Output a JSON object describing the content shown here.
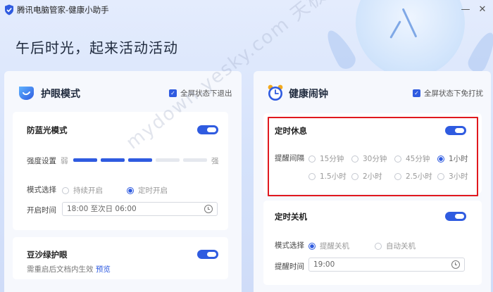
{
  "window": {
    "title": "腾讯电脑管家-健康小助手",
    "controls": {
      "minimize": "—",
      "close": "✕"
    }
  },
  "headline": "午后时光，起来活动活动",
  "watermark": "mydown.yesky.com 天极下载站",
  "eye_panel": {
    "title": "护眼模式",
    "fullscreen_exit_label": "全屏状态下退出",
    "blue_light": {
      "title": "防蓝光模式",
      "enabled": true,
      "intensity_label": "强度设置",
      "weak_label": "弱",
      "strong_label": "强",
      "intensity_level": 0.6,
      "mode_label": "模式选择",
      "modes": [
        {
          "label": "持续开启",
          "selected": false
        },
        {
          "label": "定时开启",
          "selected": true
        }
      ],
      "time_label": "开启时间",
      "time_value": "18:00 至次日 06:00"
    },
    "green_eye": {
      "title": "豆沙绿护眼",
      "enabled": true,
      "note": "需重启后文档内生效",
      "preview_link": "预览"
    }
  },
  "alarm_panel": {
    "title": "健康闹钟",
    "fullscreen_dnd_label": "全屏状态下免打扰",
    "timed_rest": {
      "title": "定时休息",
      "enabled": true,
      "interval_label": "提醒间隔",
      "options": [
        {
          "label": "15分钟",
          "selected": false
        },
        {
          "label": "30分钟",
          "selected": false
        },
        {
          "label": "45分钟",
          "selected": false
        },
        {
          "label": "1小时",
          "selected": true
        },
        {
          "label": "1.5小时",
          "selected": false
        },
        {
          "label": "2小时",
          "selected": false
        },
        {
          "label": "2.5小时",
          "selected": false
        },
        {
          "label": "3小时",
          "selected": false
        }
      ]
    },
    "timed_shutdown": {
      "title": "定时关机",
      "enabled": true,
      "mode_label": "模式选择",
      "modes": [
        {
          "label": "提醒关机",
          "selected": true
        },
        {
          "label": "自动关机",
          "selected": false
        }
      ],
      "time_label": "提醒时间",
      "time_value": "19:00"
    }
  },
  "colors": {
    "accent": "#2f5be0",
    "highlight": "#e0181e"
  }
}
